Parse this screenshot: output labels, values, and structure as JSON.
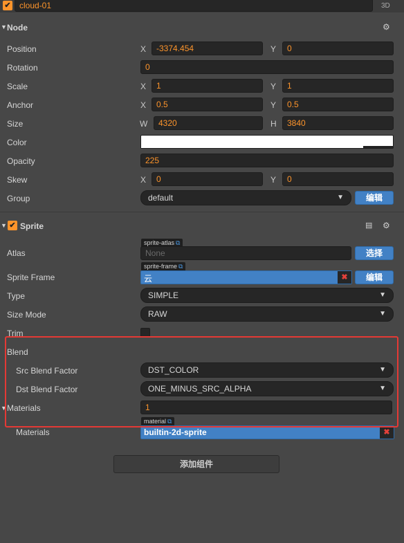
{
  "top": {
    "node_name": "cloud-01",
    "mode_label": "3D"
  },
  "node": {
    "title": "Node",
    "position": {
      "label": "Position",
      "x_axis": "X",
      "x": "-3374.454",
      "y_axis": "Y",
      "y": "0"
    },
    "rotation": {
      "label": "Rotation",
      "value": "0"
    },
    "scale": {
      "label": "Scale",
      "x_axis": "X",
      "x": "1",
      "y_axis": "Y",
      "y": "1"
    },
    "anchor": {
      "label": "Anchor",
      "x_axis": "X",
      "x": "0.5",
      "y_axis": "Y",
      "y": "0.5"
    },
    "size": {
      "label": "Size",
      "w_axis": "W",
      "w": "4320",
      "h_axis": "H",
      "h": "3840"
    },
    "color": {
      "label": "Color",
      "value": "#ffffff"
    },
    "opacity": {
      "label": "Opacity",
      "value": "225"
    },
    "skew": {
      "label": "Skew",
      "x_axis": "X",
      "x": "0",
      "y_axis": "Y",
      "y": "0"
    },
    "group": {
      "label": "Group",
      "value": "default",
      "edit_button": "编辑"
    }
  },
  "sprite": {
    "title": "Sprite",
    "atlas": {
      "label": "Atlas",
      "tag": "sprite-atlas",
      "placeholder": "None",
      "button": "选择"
    },
    "sprite_frame": {
      "label": "Sprite Frame",
      "tag": "sprite-frame",
      "value": "云",
      "button": "编辑"
    },
    "type": {
      "label": "Type",
      "value": "SIMPLE"
    },
    "size_mode": {
      "label": "Size Mode",
      "value": "RAW"
    },
    "trim": {
      "label": "Trim"
    },
    "blend": {
      "label": "Blend",
      "src": {
        "label": "Src Blend Factor",
        "value": "DST_COLOR"
      },
      "dst": {
        "label": "Dst Blend Factor",
        "value": "ONE_MINUS_SRC_ALPHA"
      }
    },
    "materials": {
      "label": "Materials",
      "count": "1",
      "item_label": "Materials",
      "tag": "material",
      "value": "builtin-2d-sprite"
    }
  },
  "add_component_button": "添加组件",
  "colors": {
    "accent": "#fd942b",
    "button": "#4281c5",
    "highlight_border": "#e53935"
  }
}
